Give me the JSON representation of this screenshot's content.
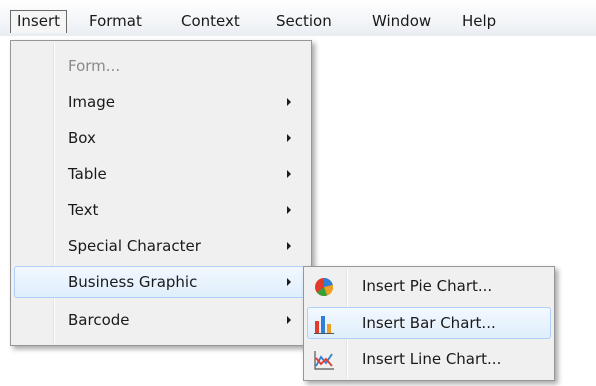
{
  "menubar": {
    "items": [
      {
        "label": "Insert"
      },
      {
        "label": "Format"
      },
      {
        "label": "Context"
      },
      {
        "label": "Section"
      },
      {
        "label": "Window"
      },
      {
        "label": "Help"
      }
    ]
  },
  "insert_menu": {
    "items": [
      {
        "label": "Form...",
        "enabled": false,
        "submenu": false
      },
      {
        "label": "Image",
        "submenu": true
      },
      {
        "label": "Box",
        "submenu": true
      },
      {
        "label": "Table",
        "submenu": true
      },
      {
        "label": "Text",
        "submenu": true
      },
      {
        "label": "Special Character",
        "submenu": true
      },
      {
        "label": "Business Graphic",
        "submenu": true,
        "highlighted": true
      },
      {
        "label": "Barcode",
        "submenu": true
      }
    ]
  },
  "business_graphic_submenu": {
    "items": [
      {
        "label": "Insert Pie Chart...",
        "icon": "pie-chart-icon"
      },
      {
        "label": "Insert Bar Chart...",
        "icon": "bar-chart-icon",
        "highlighted": true
      },
      {
        "label": "Insert Line Chart...",
        "icon": "line-chart-icon"
      }
    ]
  },
  "colors": {
    "highlight_border": "#aecff7",
    "highlight_fill": "#dfeefc",
    "menu_background": "#f0f0f0"
  }
}
